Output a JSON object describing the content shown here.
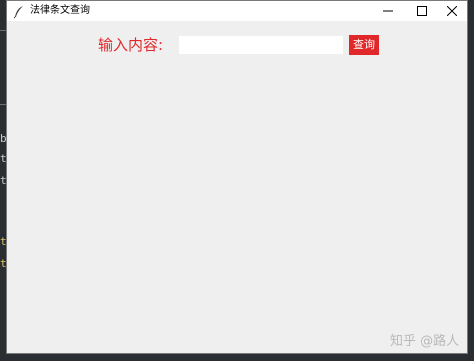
{
  "window": {
    "title": "法律条文查询",
    "title_icon": "feather-icon",
    "controls": [
      "minimize-icon",
      "maximize-icon",
      "close-icon"
    ]
  },
  "form": {
    "label": "输入内容:",
    "input_value": "",
    "button_label": "查询"
  },
  "background_terminal": {
    "chars": [
      "b",
      "t",
      "t",
      "t",
      "t"
    ]
  },
  "watermark": "知乎 @路人",
  "colors": {
    "accent": "#e0282b",
    "window_bg": "#efefef",
    "titlebar_bg": "#ffffff",
    "watermark": "#b9b9b9"
  }
}
